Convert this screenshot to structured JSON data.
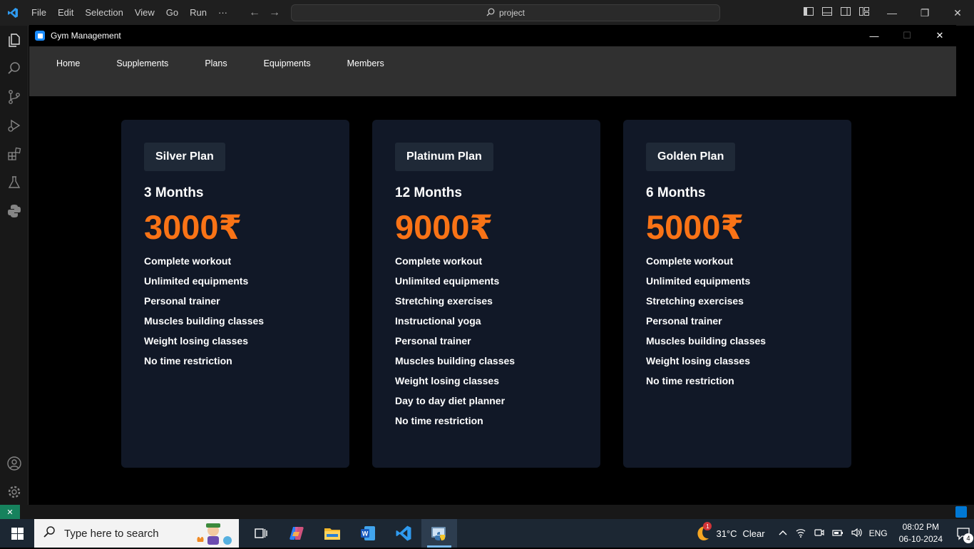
{
  "vscode": {
    "menu": [
      "File",
      "Edit",
      "Selection",
      "View",
      "Go",
      "Run",
      "···"
    ],
    "search_text": "project"
  },
  "app": {
    "title": "Gym Management",
    "nav": [
      "Home",
      "Supplements",
      "Plans",
      "Equipments",
      "Members"
    ],
    "accent_color": "#f97316",
    "card_color": "#111827",
    "plans": [
      {
        "name": "Silver Plan",
        "duration": "3 Months",
        "price": "3000₹",
        "features": [
          "Complete workout",
          "Unlimited equipments",
          "Personal trainer",
          "Muscles building classes",
          "Weight losing classes",
          "No time restriction"
        ]
      },
      {
        "name": "Platinum Plan",
        "duration": "12 Months",
        "price": "9000₹",
        "features": [
          "Complete workout",
          "Unlimited equipments",
          "Stretching exercises",
          "Instructional yoga",
          "Personal trainer",
          "Muscles building classes",
          "Weight losing classes",
          "Day to day diet planner",
          "No time restriction"
        ]
      },
      {
        "name": "Golden Plan",
        "duration": "6 Months",
        "price": "5000₹",
        "features": [
          "Complete workout",
          "Unlimited equipments",
          "Stretching exercises",
          "Personal trainer",
          "Muscles building classes",
          "Weight losing classes",
          "No time restriction"
        ]
      }
    ]
  },
  "taskbar": {
    "search_placeholder": "Type here to search",
    "temperature": "31°C",
    "weather": "Clear",
    "weather_badge": "1",
    "language": "ENG",
    "time": "08:02 PM",
    "date": "06-10-2024",
    "notification_count": "4"
  }
}
